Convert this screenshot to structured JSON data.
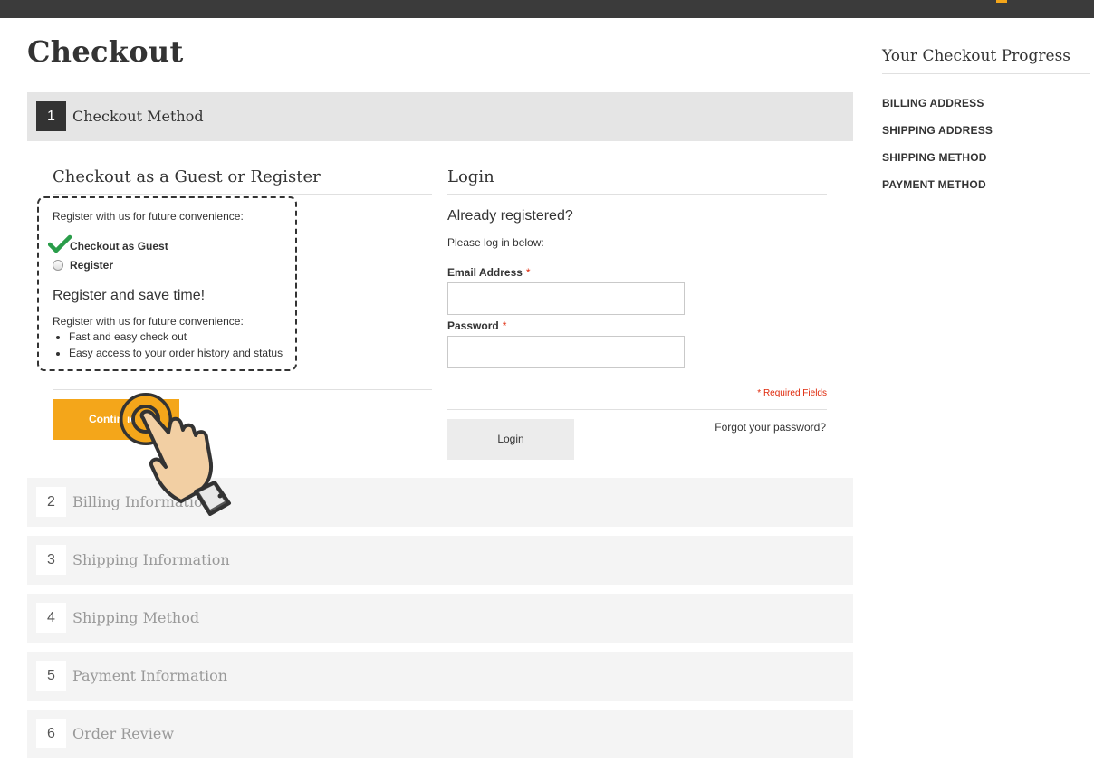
{
  "page": {
    "title": "Checkout"
  },
  "steps": [
    {
      "num": "1",
      "title": "Checkout Method"
    },
    {
      "num": "2",
      "title": "Billing Information"
    },
    {
      "num": "3",
      "title": "Shipping Information"
    },
    {
      "num": "4",
      "title": "Shipping Method"
    },
    {
      "num": "5",
      "title": "Payment Information"
    },
    {
      "num": "6",
      "title": "Order Review"
    }
  ],
  "guest": {
    "title": "Checkout as a Guest or Register",
    "intro": "Register with us for future convenience:",
    "options": [
      {
        "label": "Checkout as Guest",
        "selected": true
      },
      {
        "label": "Register",
        "selected": false
      }
    ],
    "benefit_title": "Register and save time!",
    "benefit_intro": "Register with us for future convenience:",
    "benefits": [
      "Fast and easy check out",
      "Easy access to your order history and status"
    ],
    "continue_label": "Continue"
  },
  "login": {
    "title": "Login",
    "subtitle": "Already registered?",
    "prompt": "Please log in below:",
    "email_label": "Email Address",
    "password_label": "Password",
    "required_star": "*",
    "required_note": "* Required Fields",
    "forgot": "Forgot your password?",
    "login_label": "Login"
  },
  "progress": {
    "title": "Your Checkout Progress",
    "items": [
      "BILLING ADDRESS",
      "SHIPPING ADDRESS",
      "SHIPPING METHOD",
      "PAYMENT METHOD"
    ]
  },
  "colors": {
    "accent": "#f4a61a",
    "required": "#df280a",
    "check": "#2a9d4a",
    "topbar": "#3b3b3b"
  },
  "icons": {
    "check": "check-icon",
    "hand": "hand-pointer-icon"
  }
}
